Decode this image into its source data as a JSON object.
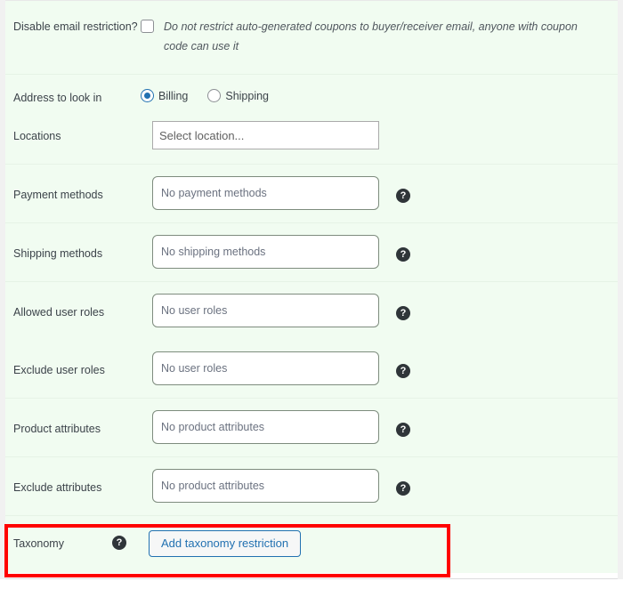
{
  "panel": {
    "rows": [
      {
        "id": "disable-email-restriction",
        "label": "Disable email restriction?",
        "description": "Do not restrict auto-generated coupons to buyer/receiver email, anyone with coupon code can use it",
        "checkbox_checked": false
      },
      {
        "id": "address-to-look-in",
        "label": "Address to look in",
        "options": [
          {
            "label": "Billing",
            "selected": true
          },
          {
            "label": "Shipping",
            "selected": false
          }
        ]
      },
      {
        "id": "locations",
        "label": "Locations",
        "placeholder": "Select location..."
      },
      {
        "id": "payment-methods",
        "label": "Payment methods",
        "placeholder": "No payment methods",
        "help": "?"
      },
      {
        "id": "shipping-methods",
        "label": "Shipping methods",
        "placeholder": "No shipping methods",
        "help": "?"
      },
      {
        "id": "allowed-user-roles",
        "label": "Allowed user roles",
        "placeholder": "No user roles",
        "help": "?"
      },
      {
        "id": "exclude-user-roles",
        "label": "Exclude user roles",
        "placeholder": "No user roles",
        "help": "?"
      },
      {
        "id": "product-attributes",
        "label": "Product attributes",
        "placeholder": "No product attributes",
        "help": "?"
      },
      {
        "id": "exclude-attributes",
        "label": "Exclude attributes",
        "placeholder": "No product attributes",
        "help": "?"
      },
      {
        "id": "taxonomy",
        "label": "Taxonomy",
        "help": "?",
        "button_label": "Add taxonomy restriction"
      }
    ]
  },
  "colors": {
    "panel_background": "#f1fcf1",
    "label_text": "#3c434a",
    "placeholder_text": "#6b7280",
    "accent_blue": "#2271b1",
    "help_icon_background": "#2f3539",
    "highlight_border": "#ff0000"
  }
}
